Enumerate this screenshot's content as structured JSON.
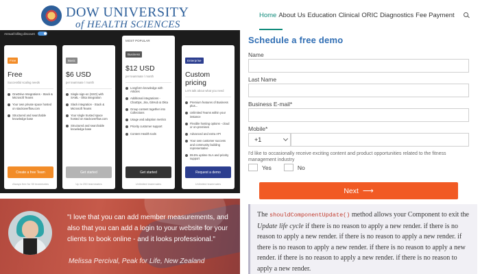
{
  "header": {
    "university_name": "DOW UNIVERSITY",
    "university_sub": "of HEALTH SCIENCES"
  },
  "pricing": {
    "billing_label": "Annual billing discount",
    "cards": [
      {
        "tier": "Free",
        "tier_color": "#f28c28",
        "popular": "",
        "price": "Free",
        "price_sub": "Successful scaling needs",
        "features": [
          "OneDrive Integrations - Stack & Microsoft Teams",
          "Your own private space hosted on stackoverflow.com",
          "Structured and searchable knowledge base"
        ],
        "cta": "Create a free Team",
        "cta_color": "#f28c28",
        "foot": "Always free for 50 teammates"
      },
      {
        "tier": "Basic",
        "tier_color": "#888888",
        "popular": "",
        "price": "$6 USD",
        "price_sub": "per teammate / month",
        "features": [
          "Single sign-on (SSO) with SAML - Okta integration",
          "Slack integration - Stack & Microsoft Teams",
          "Your single trusted space hosted on stackoverflow.com",
          "Structured and searchable knowledge base"
        ],
        "cta": "Get started",
        "cta_color": "#b5b5b5",
        "foot": "Up to 250 teammates"
      },
      {
        "tier": "Business",
        "tier_color": "#555555",
        "popular": "MOST POPULAR",
        "price": "$12 USD",
        "price_sub": "per teammate / month",
        "features": [
          "Longform knowledge with Articles",
          "Additional integrations - ChatOps, Jira, GitHub & Okta",
          "Group content together into Collections",
          "Usage and adoption metrics",
          "Priority customer support",
          "Content Health tools"
        ],
        "cta": "Get started",
        "cta_color": "#333333",
        "foot": "Unlimited teammates"
      },
      {
        "tier": "Enterprise",
        "tier_color": "#2c3e8f",
        "popular": "",
        "price": "Custom pricing",
        "price_sub": "Let's talk about what you need",
        "features": [
          "Premium features of Business plus...",
          "Unlimited Teams within your instance",
          "Flexible hosting options - cloud or on-premises",
          "Advanced and extra API",
          "Your own customer success and community building representative",
          "99.5% uptime SLA and priority support"
        ],
        "cta": "Request a demo",
        "cta_color": "#2c3e8f",
        "foot": "Unlimited teammates"
      }
    ]
  },
  "testimonial": {
    "quote": "\"I love that you can add member measurements, and also that you can add a login to your website for your clients to book online - and it looks professional.\"",
    "author": "Melissa Percival, Peak for Life, New Zealand"
  },
  "nav": {
    "items": [
      "Home",
      "About Us",
      "Education",
      "Clinical",
      "ORIC",
      "Diagnostics",
      "Fee Payment"
    ],
    "active_color": "#0e8a7a"
  },
  "form": {
    "title": "Schedule a free demo",
    "name_label": "Name",
    "last_name_label": "Last Name",
    "email_label": "Business E-mail*",
    "mobile_label": "Mobile*",
    "phone_code": "+1",
    "consent": "I'd like to occasionally receive exciting content and product opportunities related to the fitness management industry",
    "yes": "Yes",
    "no": "No",
    "next": "Next",
    "next_arrow": "⟶"
  },
  "doc": {
    "t1": "The ",
    "code": "shouldComponentUpdate()",
    "t2": " method allows your Component to exit the ",
    "em": "Update life cycle",
    "t3": " if there is no reason to apply a new render. if there is no reason to apply a new render. if there is no reason to apply a new render. if there is no reason to apply a new render. if there is no reason to apply a new render. if there is no reason to apply a new render. if there is no reason to apply a new render."
  }
}
